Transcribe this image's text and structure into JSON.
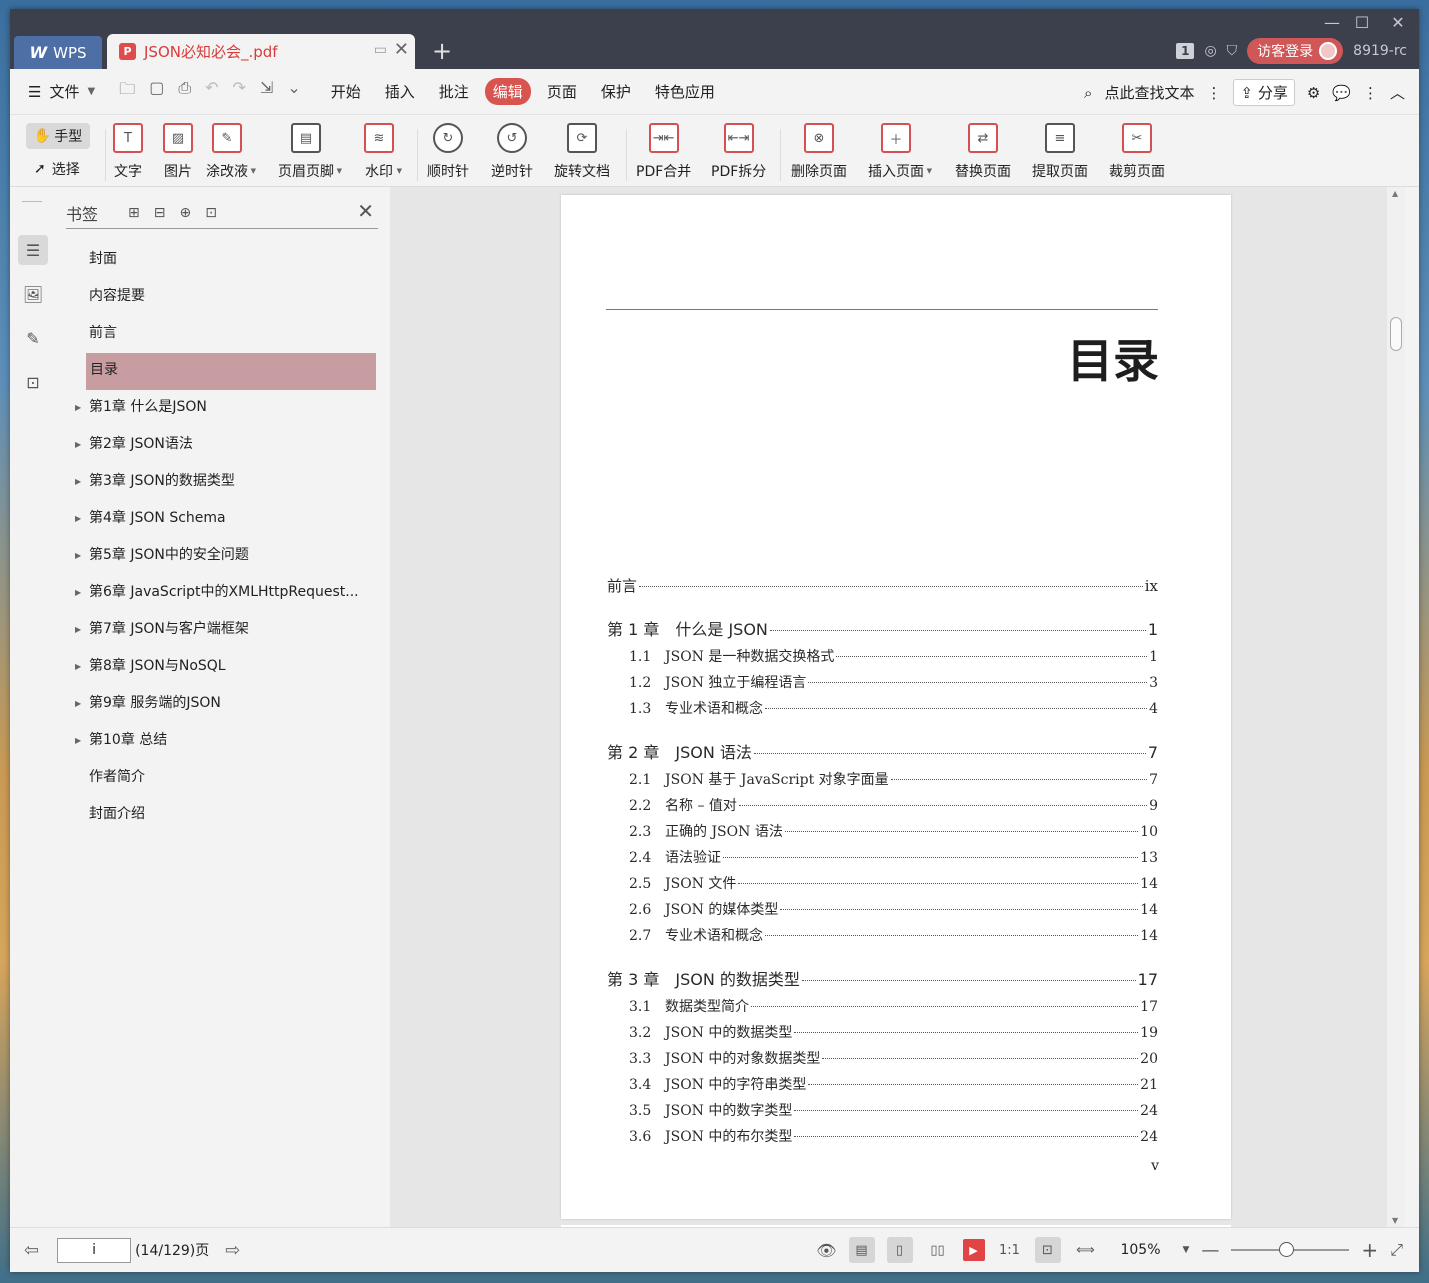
{
  "titlebar": {
    "app_tab": "WPS",
    "doc_tab": "JSON必知必会_.pdf",
    "badge_num": "1",
    "login": "访客登录",
    "account": "8919-rc"
  },
  "menubar": {
    "file": "文件",
    "items": [
      "开始",
      "插入",
      "批注",
      "编辑",
      "页面",
      "保护",
      "特色应用"
    ],
    "active": "编辑",
    "search": "点此查找文本",
    "share": "分享"
  },
  "ribbon": {
    "hand": "手型",
    "select": "选择",
    "buttons": [
      "文字",
      "图片",
      "涂改液",
      "页眉页脚",
      "水印",
      "顺时针",
      "逆时针",
      "旋转文档",
      "PDF合并",
      "PDF拆分",
      "删除页面",
      "插入页面",
      "替换页面",
      "提取页面",
      "裁剪页面"
    ]
  },
  "bookmarks": {
    "title": "书签",
    "items": [
      {
        "label": "封面",
        "expandable": false
      },
      {
        "label": "内容提要",
        "expandable": false
      },
      {
        "label": "前言",
        "expandable": false
      },
      {
        "label": "目录",
        "expandable": false,
        "selected": true
      },
      {
        "label": "第1章 什么是JSON",
        "expandable": true
      },
      {
        "label": "第2章 JSON语法",
        "expandable": true
      },
      {
        "label": "第3章 JSON的数据类型",
        "expandable": true
      },
      {
        "label": "第4章 JSON Schema",
        "expandable": true
      },
      {
        "label": "第5章 JSON中的安全问题",
        "expandable": true
      },
      {
        "label": "第6章 JavaScript中的XMLHttpRequest...",
        "expandable": true
      },
      {
        "label": "第7章 JSON与客户端框架",
        "expandable": true
      },
      {
        "label": "第8章 JSON与NoSQL",
        "expandable": true
      },
      {
        "label": "第9章 服务端的JSON",
        "expandable": true
      },
      {
        "label": "第10章 总结",
        "expandable": true
      },
      {
        "label": "作者简介",
        "expandable": false
      },
      {
        "label": "封面介绍",
        "expandable": false
      }
    ]
  },
  "page": {
    "title": "目录",
    "folio": "v",
    "toc": [
      {
        "kind": "pre",
        "title": "前言",
        "page": "ix"
      },
      {
        "kind": "chap",
        "title": "第 1 章　什么是 JSON",
        "page": "1"
      },
      {
        "kind": "sec",
        "num": "1.1",
        "title": "JSON 是一种数据交换格式",
        "page": "1"
      },
      {
        "kind": "sec",
        "num": "1.2",
        "title": "JSON 独立于编程语言",
        "page": "3"
      },
      {
        "kind": "sec",
        "num": "1.3",
        "title": "专业术语和概念",
        "page": "4"
      },
      {
        "kind": "chap",
        "title": "第 2 章　JSON 语法",
        "page": "7"
      },
      {
        "kind": "sec",
        "num": "2.1",
        "title": "JSON 基于 JavaScript 对象字面量",
        "page": "7"
      },
      {
        "kind": "sec",
        "num": "2.2",
        "title": "名称 – 值对",
        "page": "9"
      },
      {
        "kind": "sec",
        "num": "2.3",
        "title": "正确的 JSON 语法",
        "page": "10"
      },
      {
        "kind": "sec",
        "num": "2.4",
        "title": "语法验证",
        "page": "13"
      },
      {
        "kind": "sec",
        "num": "2.5",
        "title": "JSON 文件",
        "page": "14"
      },
      {
        "kind": "sec",
        "num": "2.6",
        "title": "JSON 的媒体类型",
        "page": "14"
      },
      {
        "kind": "sec",
        "num": "2.7",
        "title": "专业术语和概念",
        "page": "14"
      },
      {
        "kind": "chap",
        "title": "第 3 章　JSON 的数据类型",
        "page": "17"
      },
      {
        "kind": "sec",
        "num": "3.1",
        "title": "数据类型简介",
        "page": "17"
      },
      {
        "kind": "sec",
        "num": "3.2",
        "title": "JSON 中的数据类型",
        "page": "19"
      },
      {
        "kind": "sec",
        "num": "3.3",
        "title": "JSON 中的对象数据类型",
        "page": "20"
      },
      {
        "kind": "sec",
        "num": "3.4",
        "title": "JSON 中的字符串类型",
        "page": "21"
      },
      {
        "kind": "sec",
        "num": "3.5",
        "title": "JSON 中的数字类型",
        "page": "24"
      },
      {
        "kind": "sec",
        "num": "3.6",
        "title": "JSON 中的布尔类型",
        "page": "24"
      }
    ]
  },
  "status": {
    "page_input": "i",
    "page_count": "(14/129)页",
    "zoom": "105%"
  }
}
